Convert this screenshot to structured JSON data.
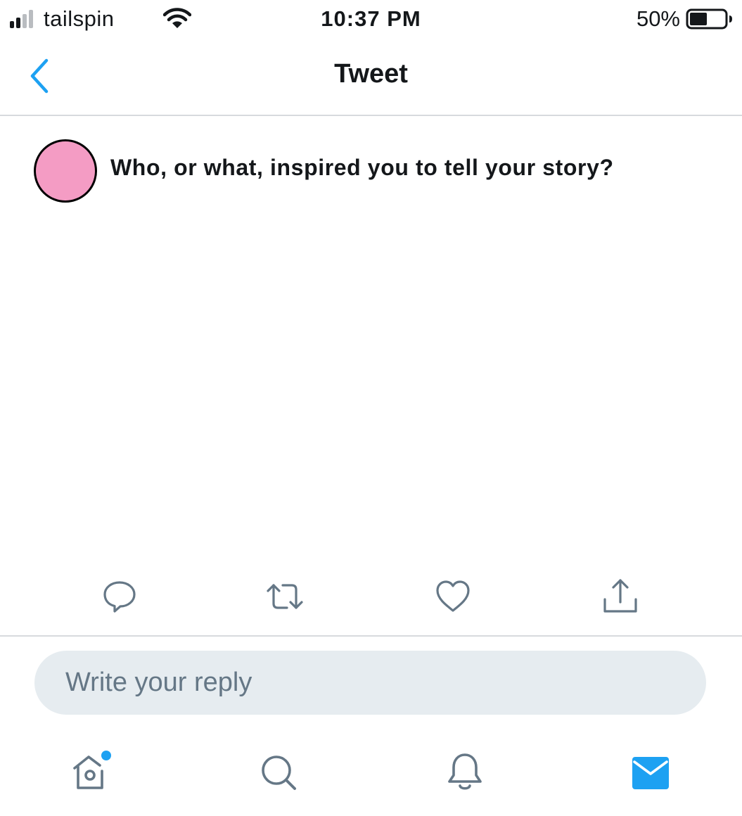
{
  "status_bar": {
    "carrier": "tailspin",
    "time": "10:37 PM",
    "battery_percent": "50%",
    "battery_level": 0.5,
    "signal_bars": 2
  },
  "nav": {
    "back_icon": "chevron-left-icon",
    "title": "Tweet"
  },
  "tweet": {
    "avatar_color": "#f49cc4",
    "text": "Who, or what, inspired you to tell your story?",
    "actions": [
      {
        "name": "reply",
        "icon": "speech-bubble-icon"
      },
      {
        "name": "retweet",
        "icon": "retweet-icon"
      },
      {
        "name": "like",
        "icon": "heart-icon"
      },
      {
        "name": "share",
        "icon": "share-icon"
      }
    ]
  },
  "reply": {
    "placeholder": "Write your reply"
  },
  "tab_bar": {
    "tabs": [
      {
        "name": "home",
        "icon": "birdhouse-icon",
        "active": false,
        "has_notification_dot": true
      },
      {
        "name": "search",
        "icon": "magnifier-icon",
        "active": false
      },
      {
        "name": "notifications",
        "icon": "bell-icon",
        "active": false
      },
      {
        "name": "messages",
        "icon": "envelope-icon",
        "active": true
      }
    ]
  },
  "colors": {
    "accent": "#1da1f2",
    "icon_gray": "#657786",
    "reply_bg": "#e6ecf0",
    "divider": "#d7dadd",
    "text": "#14171a"
  }
}
